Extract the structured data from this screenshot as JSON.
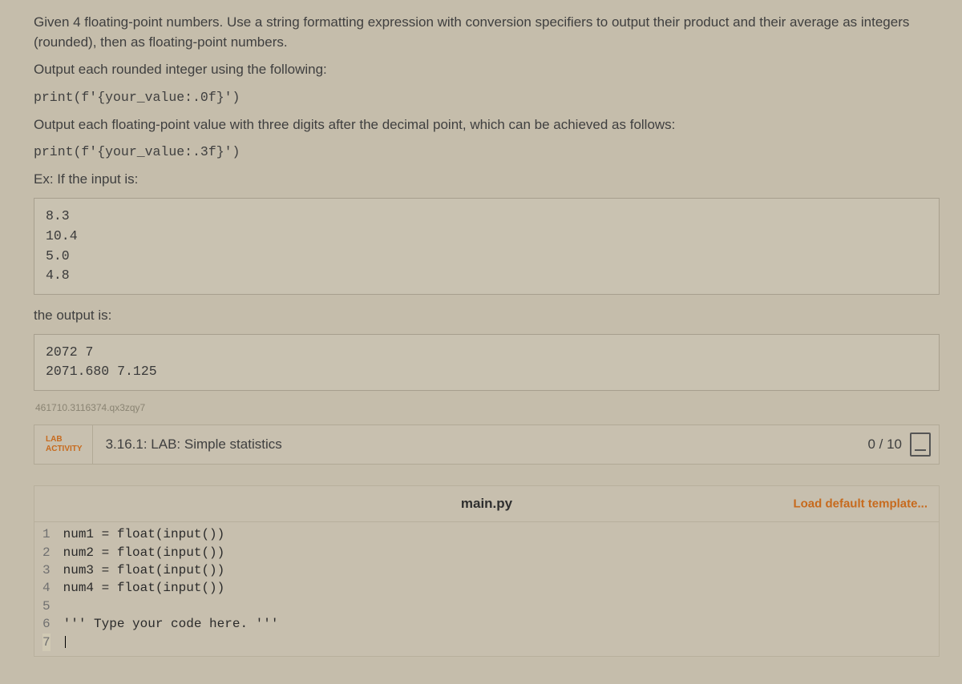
{
  "problem": {
    "p1": "Given 4 floating-point numbers. Use a string formatting expression with conversion specifiers to output their product and their average as integers (rounded), then as floating-point numbers.",
    "p2": "Output each rounded integer using the following:",
    "snip1": "print(f'{your_value:.0f}')",
    "p3": "Output each floating-point value with three digits after the decimal point, which can be achieved as follows:",
    "snip2": "print(f'{your_value:.3f}')",
    "ex_label": "Ex: If the input is:",
    "input_box": "8.3\n10.4\n5.0\n4.8",
    "output_label": "the output is:",
    "output_box": "2072 7\n2071.680 7.125",
    "qid": "461710.3116374.qx3zqy7"
  },
  "lab": {
    "label_line1": "LAB",
    "label_line2": "ACTIVITY",
    "title": "3.16.1: LAB: Simple statistics",
    "score": "0 / 10"
  },
  "editor": {
    "filename": "main.py",
    "load_template": "Load default template...",
    "lines": [
      "num1 = float(input())",
      "num2 = float(input())",
      "num3 = float(input())",
      "num4 = float(input())",
      "",
      "''' Type your code here. '''",
      ""
    ],
    "line_numbers": [
      "1",
      "2",
      "3",
      "4",
      "5",
      "6",
      "7"
    ],
    "highlighted_line": 7
  }
}
